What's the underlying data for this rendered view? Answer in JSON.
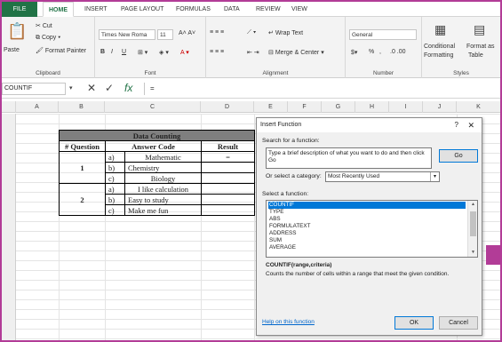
{
  "ribbon": {
    "file_tab": "FILE",
    "tabs": [
      "HOME",
      "INSERT",
      "PAGE LAYOUT",
      "FORMULAS",
      "DATA",
      "REVIEW",
      "VIEW"
    ],
    "clipboard": {
      "paste": "Paste",
      "cut": "Cut",
      "copy": "Copy",
      "format_painter": "Format Painter",
      "label": "Clipboard"
    },
    "font": {
      "name": "Times New Roma",
      "size": "11",
      "label": "Font"
    },
    "alignment": {
      "wrap_text": "Wrap Text",
      "merge_center": "Merge & Center",
      "label": "Alignment"
    },
    "number": {
      "format": "General",
      "label": "Number",
      "percent": "%"
    },
    "styles": {
      "conditional": "Conditional",
      "formatting": "Formatting",
      "format_as": "Format as",
      "table": "Table",
      "label": "Styles"
    }
  },
  "formula_bar": {
    "name_box": "COUNTIF",
    "value": "="
  },
  "columns": [
    "A",
    "B",
    "C",
    "D",
    "E",
    "F",
    "G",
    "H",
    "I",
    "J",
    "K"
  ],
  "table": {
    "title": "Data Counting",
    "headers": [
      "# Question",
      "Answer Code",
      "Result"
    ],
    "q1": "1",
    "q2": "2",
    "result_value": "=",
    "rows1": [
      {
        "letter": "a)",
        "answer": "Mathematic"
      },
      {
        "letter": "b)",
        "answer": "Chemistry"
      },
      {
        "letter": "c)",
        "answer": "Biology"
      }
    ],
    "rows2": [
      {
        "letter": "a)",
        "answer": "I like calculation"
      },
      {
        "letter": "b)",
        "answer": "Easy to study"
      },
      {
        "letter": "c)",
        "answer": "Make me fun"
      }
    ]
  },
  "dialog": {
    "title": "Insert Function",
    "help_glyph": "?",
    "close_glyph": "✕",
    "search_label": "Search for a function:",
    "search_value": "Type a brief description of what you want to do and then click Go",
    "go": "Go",
    "category_label": "Or select a category:",
    "category": "Most Recently Used",
    "select_label": "Select a function:",
    "functions": [
      "COUNTIF",
      "TYPE",
      "ABS",
      "FORMULATEXT",
      "ADDRESS",
      "SUM",
      "AVERAGE"
    ],
    "syntax": "COUNTIF(range,criteria)",
    "description": "Counts the number of cells within a range that meet the given condition.",
    "help_link": "Help on this function",
    "ok": "OK",
    "cancel": "Cancel"
  }
}
